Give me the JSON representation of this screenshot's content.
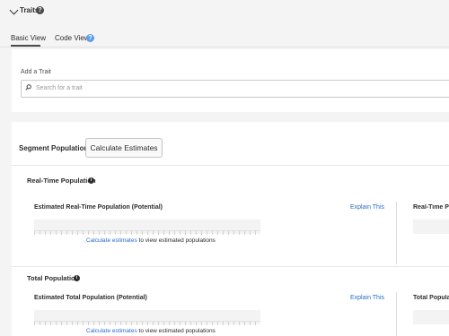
{
  "traits": {
    "title": "Traits",
    "help_glyph": "?"
  },
  "tabs": [
    {
      "label": "Basic View",
      "active": true
    },
    {
      "label": "Code View",
      "active": false
    }
  ],
  "add_trait": {
    "label": "Add a Trait",
    "placeholder": "Search for a trait"
  },
  "segment_populations": {
    "label": "Segment Populations",
    "button_label": "Calculate Estimates"
  },
  "real_time": {
    "title": "Real-Time Population",
    "panel_title": "Estimated Real-Time Population (Potential)",
    "explain_label": "Explain This",
    "right_panel_title": "Real-Time Po",
    "calc_link": "Calculate estimates",
    "calc_rest": " to view estimated populations"
  },
  "total": {
    "title": "Total Population",
    "panel_title": "Estimated Total Population (Potential)",
    "explain_label": "Explain This",
    "right_panel_title": "Total Populat",
    "calc_link": "Calculate estimates",
    "calc_rest": " to view estimated populations"
  },
  "colors": {
    "link": "#2a6cc9",
    "help_blue": "#5e9cf0",
    "background": "#f4f4f4"
  }
}
